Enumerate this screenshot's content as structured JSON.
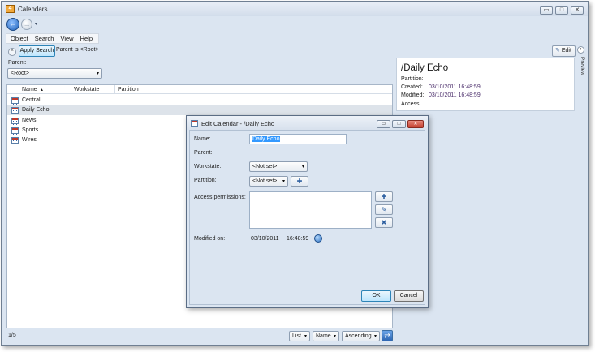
{
  "window": {
    "title": "Calendars",
    "app_icon_glyph": "4",
    "controls": [
      "minimize-icon",
      "maximize-icon",
      "close-icon"
    ],
    "control_glyphs": [
      "▭",
      "□",
      "✕"
    ]
  },
  "nav": {
    "back_glyph": "←",
    "forward_glyph": "→",
    "dropdown_glyph": "▾"
  },
  "menubar": {
    "items": [
      "Object",
      "Search",
      "View",
      "Help"
    ]
  },
  "search": {
    "expander_glyph": "^",
    "apply_label": "Apply Search",
    "parent_is": "Parent is <Root>"
  },
  "parent": {
    "label": "Parent:",
    "value": "<Root>"
  },
  "list": {
    "columns": [
      "Name",
      "Workstate",
      "Partition"
    ],
    "sort_glyph": "▲",
    "rows": [
      {
        "name": "Central",
        "selected": false
      },
      {
        "name": "Daily Echo",
        "selected": true
      },
      {
        "name": "News",
        "selected": false
      },
      {
        "name": "Sports",
        "selected": false
      },
      {
        "name": "Wires",
        "selected": false
      }
    ]
  },
  "status": {
    "count": "1/5",
    "view_mode": "List",
    "sort_by": "Name",
    "sort_dir": "Ascending",
    "refresh_glyph": "⇄"
  },
  "preview": {
    "edit_label": "Edit",
    "edit_glyph": "✎",
    "tab_label": "Preview",
    "chevron": "›",
    "title": "/Daily Echo",
    "partition_label": "Partition:",
    "created_label": "Created:",
    "created_value": "03/10/2011 16:48:59",
    "modified_label": "Modified:",
    "modified_value": "03/10/2011 16:48:59",
    "access_label": "Access:"
  },
  "dialog": {
    "title": "Edit Calendar - /Daily Echo",
    "controls": [
      "▭",
      "□",
      "✕"
    ],
    "name_label": "Name:",
    "name_value": "Daily Echo",
    "parent_label": "Parent:",
    "workstate_label": "Workstate:",
    "workstate_value": "<Not set>",
    "partition_label": "Partition:",
    "partition_value": "<Not set>",
    "access_label": "Access permissions:",
    "modified_label": "Modified on:",
    "modified_date": "03/10/2011",
    "modified_time": "16:48:59",
    "ok_label": "OK",
    "cancel_label": "Cancel",
    "combo_arrow": "▾",
    "side_button_glyphs": [
      "✚",
      "✎",
      "✖"
    ]
  }
}
